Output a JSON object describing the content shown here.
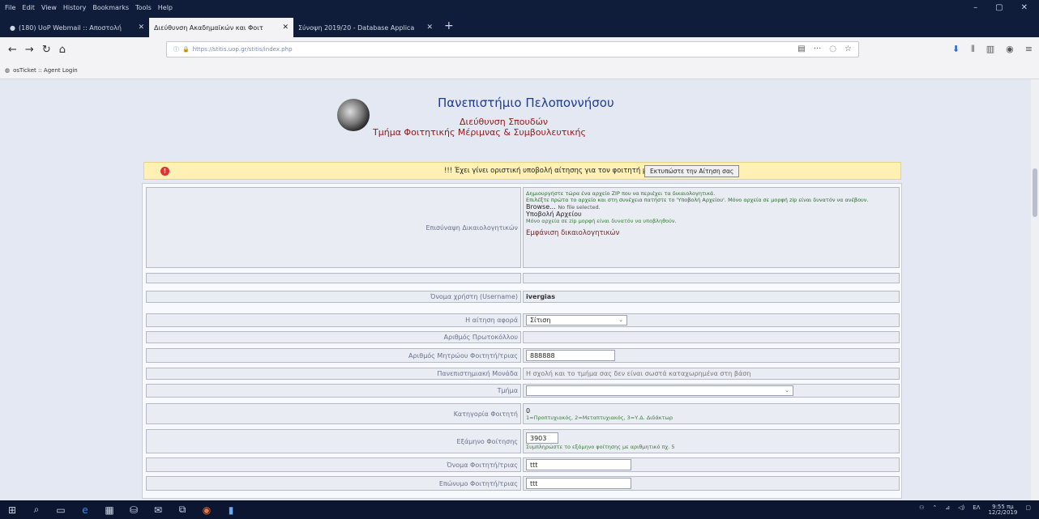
{
  "menubar": {
    "items": [
      "File",
      "Edit",
      "View",
      "History",
      "Bookmarks",
      "Tools",
      "Help"
    ]
  },
  "tabs": [
    {
      "label": "(180) UoP Webmail :: Αποστολή",
      "active": false
    },
    {
      "label": "Διεύθυνση Ακαδημαϊκών και Φοιτ",
      "active": true
    },
    {
      "label": "Σύνοψη 2019/20 - Database Applica",
      "active": false
    }
  ],
  "nav": {
    "url": "https://stitis.uop.gr/stitis/index.php"
  },
  "bookmarks": {
    "item": "osTicket :: Agent Login"
  },
  "header": {
    "university": "Πανεπιστήμιο Πελοποννήσου",
    "directorate": "Διεύθυνση Σπουδών",
    "department": "Τμήμα Φοιτητικής Μέριμνας & Συμβουλευτικής"
  },
  "notice": {
    "text": "!!! Έχει γίνει οριστική υποβολή αίτησης για τον φοιτητή με ΑΜ 888888 !!!",
    "button": "Εκτυπώστε την Αίτηση σας"
  },
  "form": {
    "upload_label": "Επισύναψη Δικαιολογητικών",
    "upload_info": "Δημιουργήστε τώρα ένα αρχείο ZIP που να περιέχει τα δικαιολογητικά.",
    "upload_info2": "Επιλέξτε πρώτα το αρχείο και στη συνέχεια πατήστε το 'Υποβολή Αρχείου'. Μόνο αρχεία σε μορφή zip είναι δυνατόν να ανέβουν.",
    "browse_button": "Browse...",
    "no_file": "No file selected.",
    "submit_file_button": "Υποβολή Αρχείου",
    "only_zip": "Μόνο αρχεία σε zip μορφή είναι δυνατόν να υποβληθούν.",
    "attached_label": "Εμφάνιση δικαιολογητικών",
    "username_label": "Όνομα χρήστη (Username)",
    "username_value": "ivergias",
    "request_for_label": "Η αίτηση αφορά",
    "request_for_value": "Σίτιση",
    "protocol_label": "Αριθμός Πρωτοκόλλου",
    "am_label": "Αριθμός Μητρώου Φοιτητή/τριας",
    "am_value": "888888",
    "school_label": "Πανεπιστημιακή Μονάδα",
    "school_value": "Η σχολή και το τμήμα σας δεν είναι σωστά καταχωρημένα στη βάση",
    "dept_label": "Τμήμα",
    "dept_value": "",
    "category_label": "Κατηγορία Φοιτητή",
    "category_value": "0",
    "category_hint": "1=Προπτυχιακός, 2=Μεταπτυχιακός, 3=Υ.Δ. Διδάκτωρ",
    "semester_label": "Εξάμηνο Φοίτησης",
    "semester_value": "3903",
    "semester_hint": "Συμπληρώστε το εξάμηνο φοίτησης με αριθμητικό πχ. 5",
    "firstname_label": "Όνομα Φοιτητή/τριας",
    "firstname_value": "ttt",
    "lastname_label": "Επώνυμο Φοιτητή/τριας",
    "lastname_value": "ttt"
  },
  "taskbar": {
    "time": "9:55 πμ",
    "date": "12/2/2019",
    "lang": "ΕΛ"
  }
}
